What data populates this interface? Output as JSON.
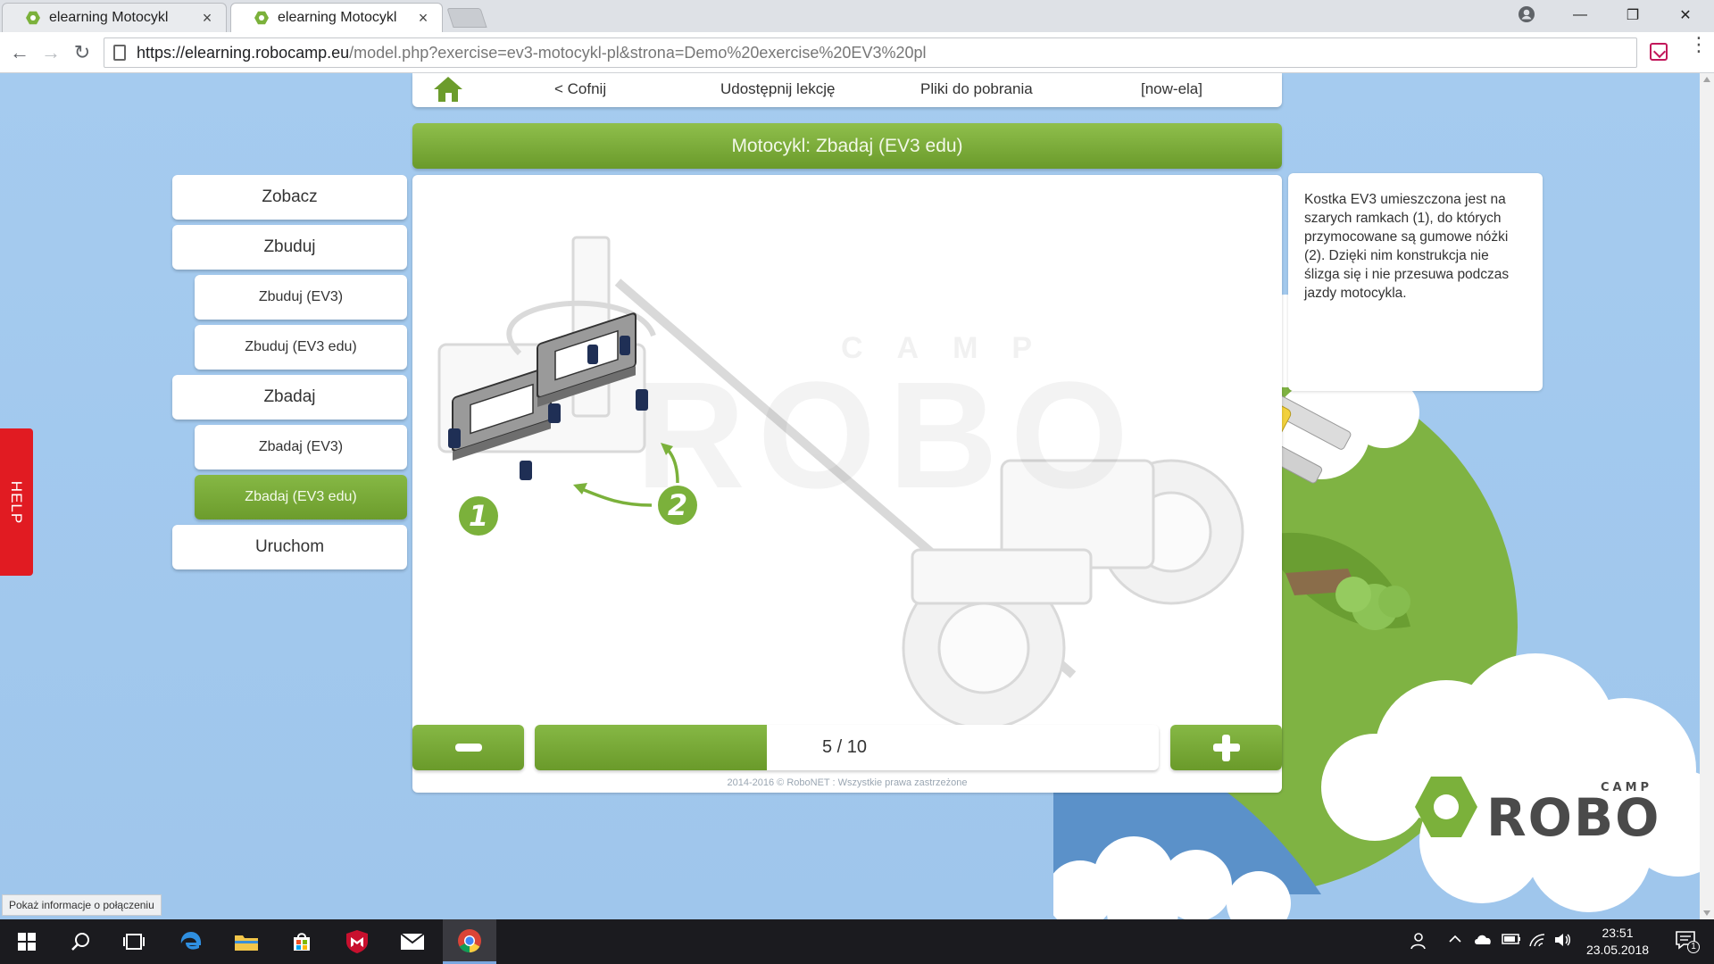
{
  "browser": {
    "tabs": [
      {
        "title": "elearning Motocykl",
        "active": false
      },
      {
        "title": "elearning Motocykl",
        "active": true
      }
    ],
    "close_glyph": "×",
    "window_controls": {
      "minimize": "—",
      "maximize": "❐",
      "close": "✕"
    },
    "nav": {
      "back": "←",
      "forward": "→",
      "reload": "↻"
    },
    "url_host": "https://elearning.robocamp.eu",
    "url_path": "/model.php?exercise=ev3-motocykl-pl&strona=Demo%20exercise%20EV3%20pl",
    "menu_dots": "⋮"
  },
  "topnav": {
    "back": "< Cofnij",
    "share": "Udostępnij lekcję",
    "downloads": "Pliki do pobrania",
    "user": "[now-ela]"
  },
  "lesson_title": "Motocykl: Zbadaj (EV3 edu)",
  "sidebar": {
    "items": [
      {
        "label": "Zobacz",
        "level": "main",
        "active": false
      },
      {
        "label": "Zbuduj",
        "level": "main",
        "active": false
      },
      {
        "label": "Zbuduj (EV3)",
        "level": "sub",
        "active": false
      },
      {
        "label": "Zbuduj (EV3 edu)",
        "level": "sub",
        "active": false
      },
      {
        "label": "Zbadaj",
        "level": "main",
        "active": false
      },
      {
        "label": "Zbadaj (EV3)",
        "level": "sub",
        "active": false
      },
      {
        "label": "Zbadaj (EV3 edu)",
        "level": "sub",
        "active": true
      },
      {
        "label": "Uruchom",
        "level": "main",
        "active": false
      }
    ]
  },
  "illustration": {
    "watermark_word": "ROBO",
    "watermark_small": "CAMP",
    "callouts": [
      "1",
      "2"
    ]
  },
  "description": "Kostka EV3 umieszczona jest na szarych ramkach (1), do których przymocowane są gumowe nóżki (2). Dzięki nim konstrukcja nie ślizga się i nie przesuwa podczas jazdy motocykla.",
  "pager": {
    "current": 5,
    "total": 10,
    "label": "5 / 10",
    "progress_fraction": 0.372
  },
  "copyright": "2014-2016 © RoboNET : Wszystkie prawa zastrzeżone",
  "help_tab": "HELP",
  "status_bubble": "Pokaż informacje o połączeniu",
  "logo": {
    "word": "ROBO",
    "small": "CAMP"
  },
  "colors": {
    "brand_green": "#7bb13b",
    "sky_blue": "#a3c9ee",
    "help_red": "#e11b22"
  },
  "taskbar": {
    "time": "23:51",
    "date": "23.05.2018",
    "notification_count": "1",
    "apps": [
      "windows-start-icon",
      "search-icon",
      "task-view-icon",
      "edge-icon",
      "file-explorer-icon",
      "store-icon",
      "mcafee-icon",
      "mail-icon",
      "chrome-icon"
    ]
  }
}
